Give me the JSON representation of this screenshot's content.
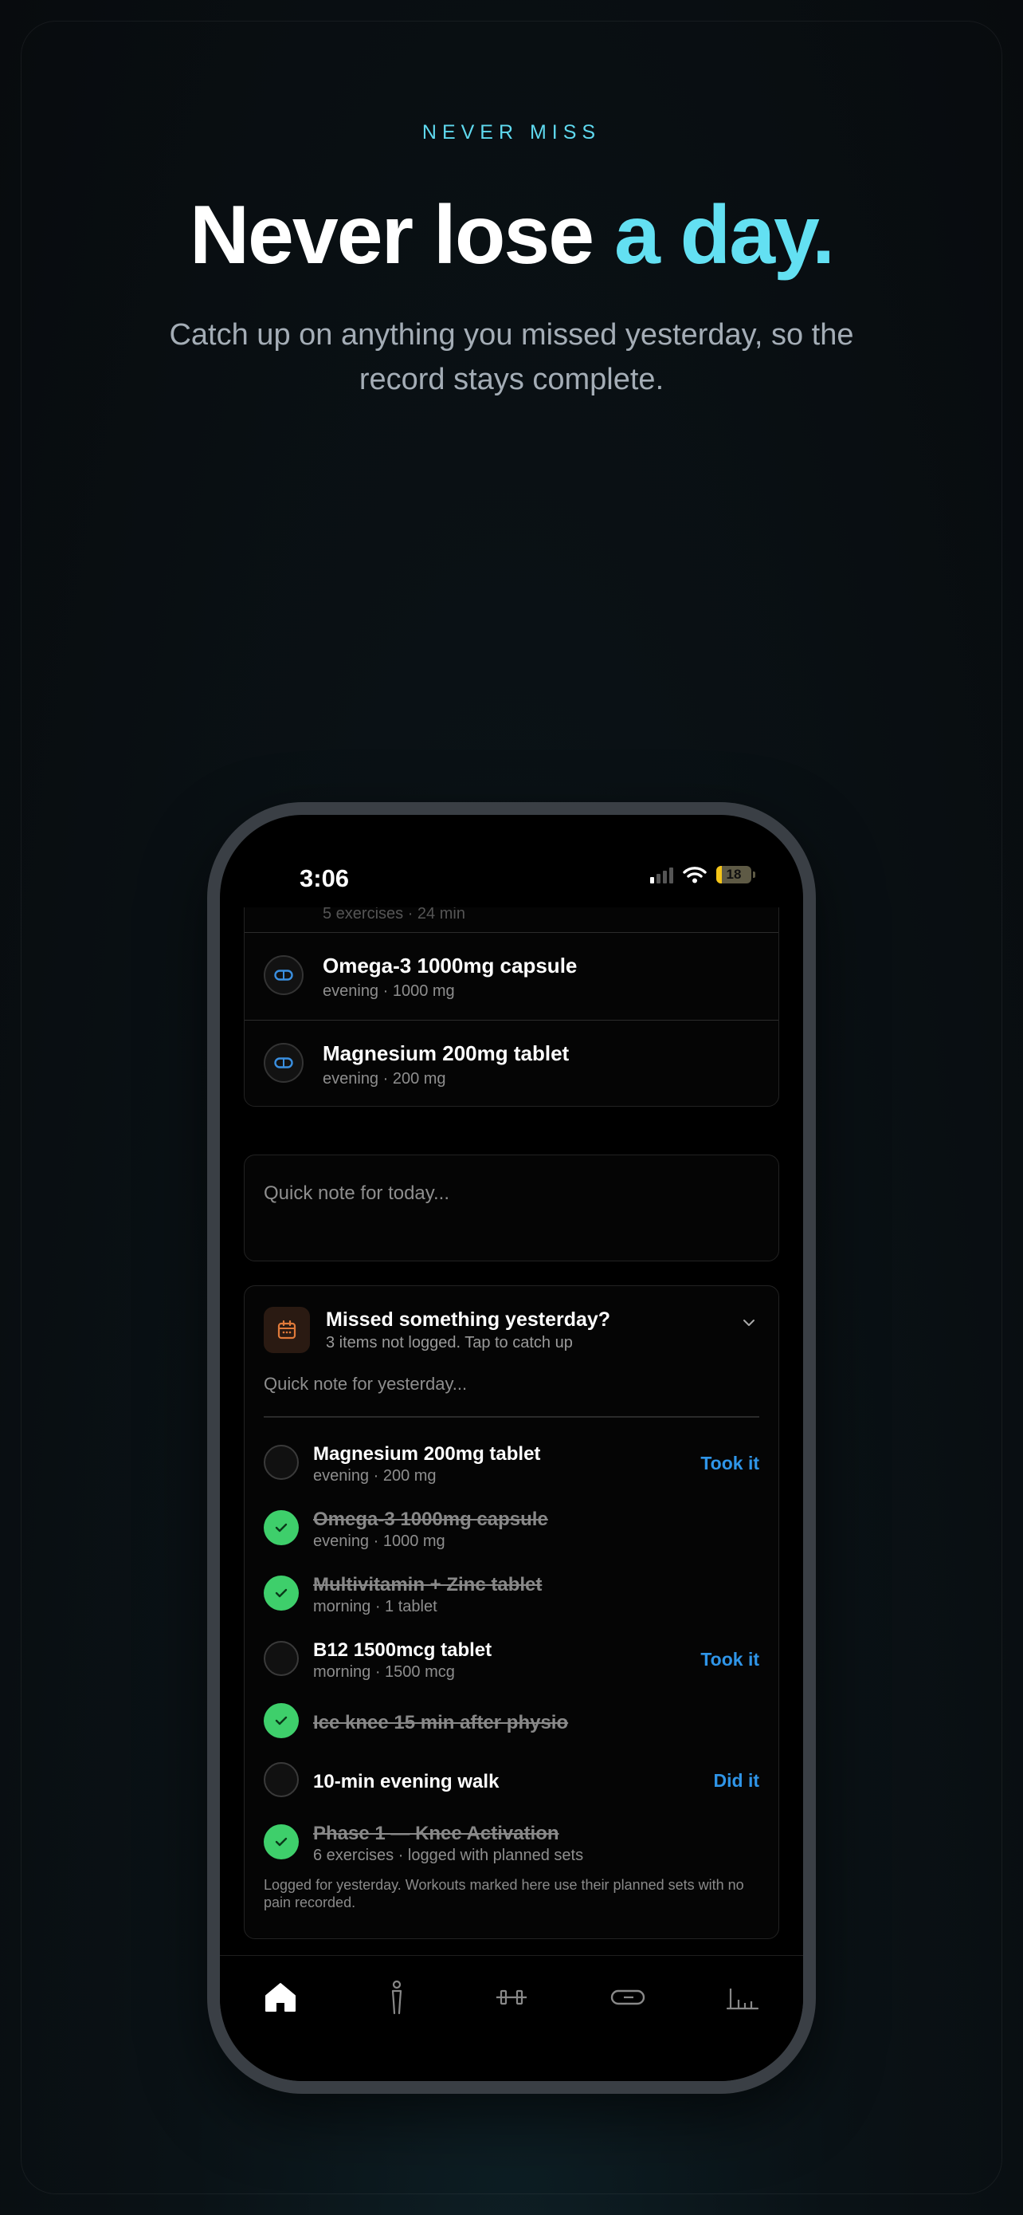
{
  "hero": {
    "eyebrow": "NEVER MISS",
    "headline_main": "Never lose ",
    "headline_accent": "a day.",
    "subtitle": "Catch up on anything you missed yesterday, so the record stays complete."
  },
  "status_bar": {
    "time": "3:06",
    "battery": "18"
  },
  "today_list": {
    "partial_row_sub": "5 exercises · 24 min",
    "items": [
      {
        "name": "Omega-3 1000mg capsule",
        "sub": "evening · 1000 mg"
      },
      {
        "name": "Magnesium 200mg tablet",
        "sub": "evening · 200 mg"
      }
    ]
  },
  "today_note": {
    "placeholder": "Quick note for today..."
  },
  "missed": {
    "title": "Missed something yesterday?",
    "subtitle": "3 items not logged. Tap to catch up",
    "note_placeholder": "Quick note for yesterday...",
    "items": [
      {
        "name": "Magnesium 200mg tablet",
        "sub": "evening · 200 mg",
        "done": false,
        "action": "Took it"
      },
      {
        "name": "Omega-3 1000mg capsule",
        "sub": "evening · 1000 mg",
        "done": true,
        "action": ""
      },
      {
        "name": "Multivitamin + Zinc tablet",
        "sub": "morning · 1 tablet",
        "done": true,
        "action": ""
      },
      {
        "name": "B12 1500mcg tablet",
        "sub": "morning · 1500 mcg",
        "done": false,
        "action": "Took it"
      },
      {
        "name": "Ice knee 15 min after physio",
        "sub": "",
        "done": true,
        "action": ""
      },
      {
        "name": "10-min evening walk",
        "sub": "",
        "done": false,
        "action": "Did it"
      },
      {
        "name": "Phase 1 — Knee Activation",
        "sub": "6 exercises · logged with planned sets",
        "done": true,
        "action": ""
      }
    ],
    "footnote": "Logged for yesterday. Workouts marked here use their planned sets with no pain recorded."
  },
  "tabs": [
    {
      "icon": "home-icon",
      "active": true
    },
    {
      "icon": "person-icon",
      "active": false
    },
    {
      "icon": "dumbbell-icon",
      "active": false
    },
    {
      "icon": "pill-icon",
      "active": false
    },
    {
      "icon": "chart-icon",
      "active": false
    }
  ],
  "colors": {
    "accent": "#63e0f2",
    "action_blue": "#2f95e8",
    "done_green": "#3ecf6b"
  }
}
